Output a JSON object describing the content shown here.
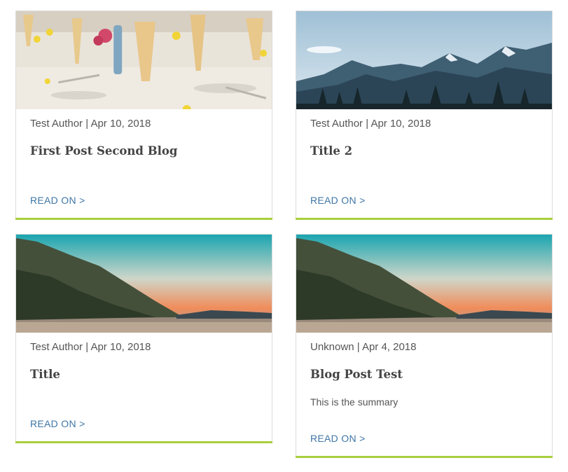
{
  "accent_color": "#a8cf3e",
  "link_color": "#3f76a6",
  "cards": [
    {
      "image": "table-setting-photo",
      "meta": "Test Author | Apr 10, 2018",
      "title": "First Post Second Blog",
      "summary": "",
      "read_label": "READ ON >"
    },
    {
      "image": "mountain-landscape-photo",
      "meta": "Test Author | Apr 10, 2018",
      "title": "Title 2",
      "summary": "",
      "read_label": "READ ON >"
    },
    {
      "image": "coastal-sunset-photo",
      "meta": "Test Author | Apr 10, 2018",
      "title": "Title",
      "summary": "",
      "read_label": "READ ON >"
    },
    {
      "image": "coastal-sunset-photo",
      "meta": "Unknown | Apr 4, 2018",
      "title": "Blog Post Test",
      "summary": "This is the summary",
      "read_label": "READ ON >"
    }
  ]
}
